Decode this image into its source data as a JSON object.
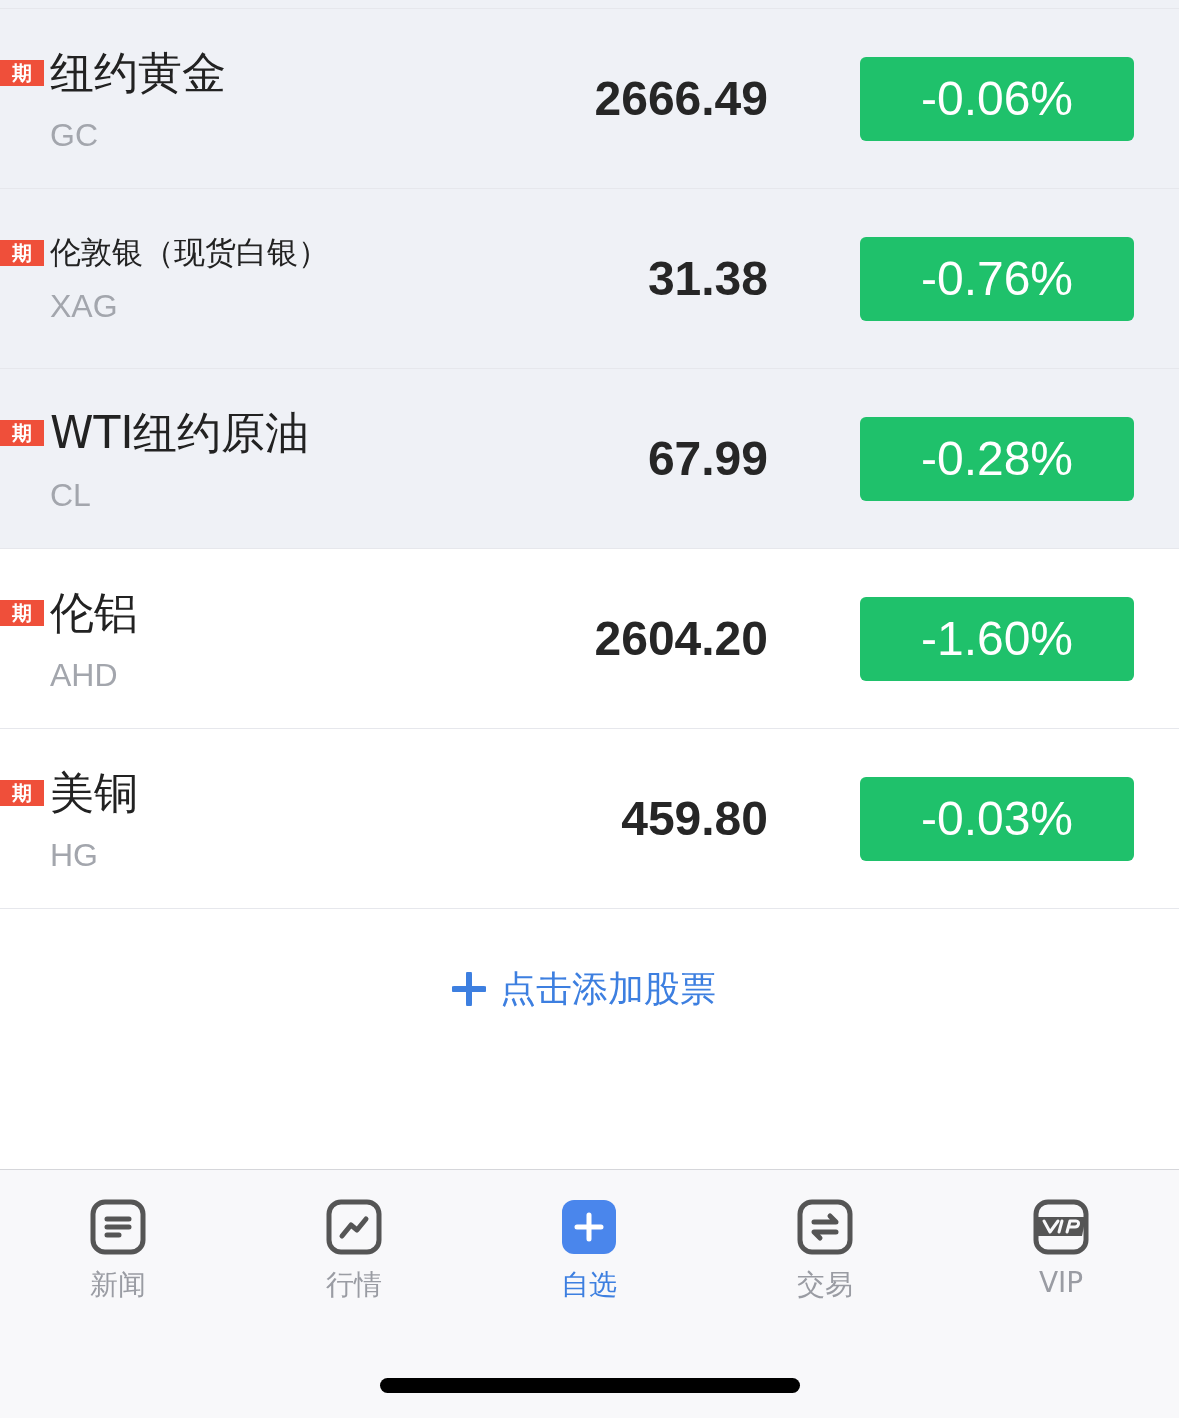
{
  "watchlist": [
    {
      "badge": "期",
      "name": "纽约黄金",
      "symbol": "GC",
      "price": "2666.49",
      "change": "-0.06%",
      "highlighted": true
    },
    {
      "badge": "期",
      "name": "伦敦银（现货白银）",
      "symbol": "XAG",
      "price": "31.38",
      "change": "-0.76%",
      "highlighted": true
    },
    {
      "badge": "期",
      "name": "WTI纽约原油",
      "symbol": "CL",
      "price": "67.99",
      "change": "-0.28%",
      "highlighted": true
    },
    {
      "badge": "期",
      "name": "伦铝",
      "symbol": "AHD",
      "price": "2604.20",
      "change": "-1.60%",
      "highlighted": false
    },
    {
      "badge": "期",
      "name": "美铜",
      "symbol": "HG",
      "price": "459.80",
      "change": "-0.03%",
      "highlighted": false
    }
  ],
  "add_button": "点击添加股票",
  "tab_bar": [
    {
      "kind": "news",
      "label": "新闻",
      "selected": false
    },
    {
      "kind": "market",
      "label": "行情",
      "selected": false
    },
    {
      "kind": "watchlist",
      "label": "自选",
      "selected": true
    },
    {
      "kind": "trade",
      "label": "交易",
      "selected": false
    },
    {
      "kind": "vip",
      "label": "VIP",
      "selected": false
    }
  ]
}
